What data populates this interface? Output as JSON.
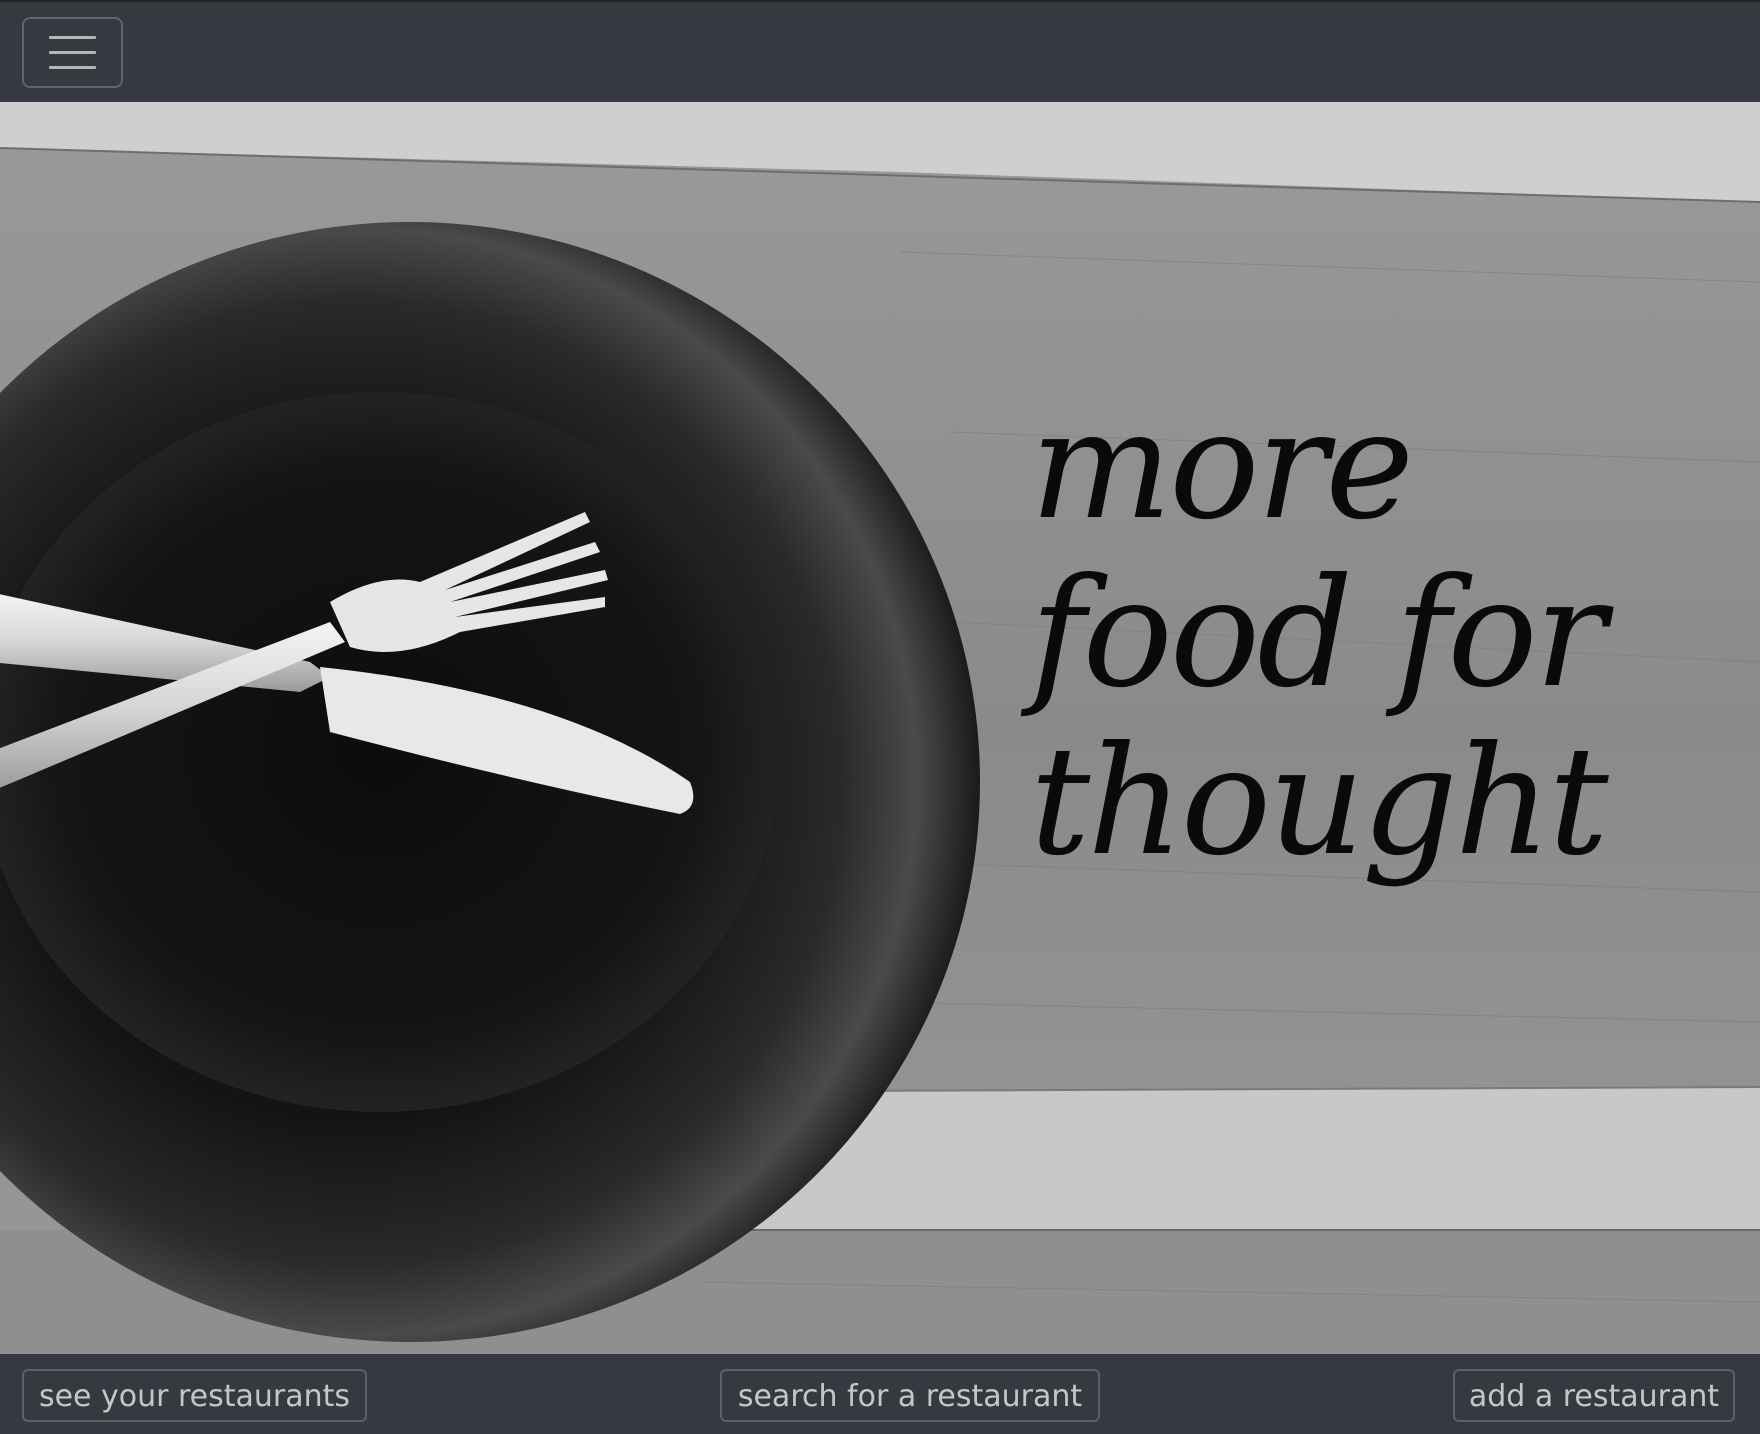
{
  "navbar": {
    "toggler_icon": "hamburger-menu-icon"
  },
  "hero": {
    "image": "black-plate-with-crossed-fork-and-knife-on-wooden-table",
    "tagline": {
      "line1": "more",
      "line2": "food for",
      "line3": "thought"
    }
  },
  "footer": {
    "see_label": "see your restaurants",
    "search_label": "search for a restaurant",
    "add_label": "add a restaurant"
  },
  "colors": {
    "bar_background": "#343a40",
    "button_border": "#5b6167",
    "button_text": "#c4c7ca"
  }
}
